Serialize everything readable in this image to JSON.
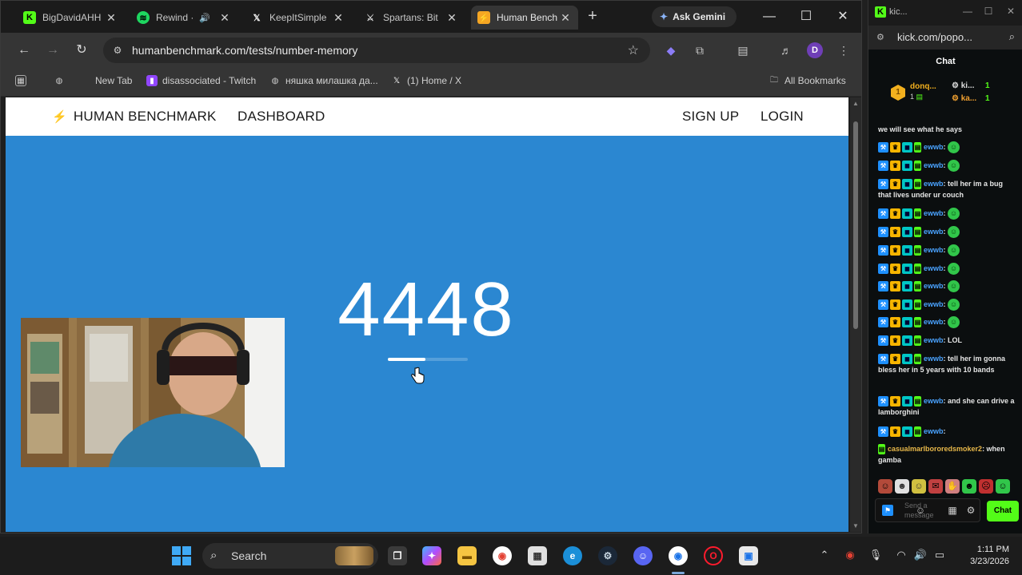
{
  "browser": {
    "tabs": [
      {
        "title": "BigDavidAHH",
        "fav": "K",
        "fav_color": "#53fc18",
        "active": false
      },
      {
        "title": "Rewind ·",
        "fav": "♫",
        "fav_color": "#1ed760",
        "active": false
      },
      {
        "title": "KeepItSimple",
        "fav": "𝕏",
        "fav_color": "#000000",
        "active": false
      },
      {
        "title": "Spartans: Bit",
        "fav": "⚔",
        "fav_color": "#777777",
        "active": false
      },
      {
        "title": "Human Bench",
        "fav": "⚡",
        "fav_color": "#f5a623",
        "active": true
      }
    ],
    "gemini_label": "Ask Gemini",
    "url": "humanbenchmark.com/tests/number-memory",
    "profile_initial": "D",
    "bookmarks": [
      {
        "label": "New Tab"
      },
      {
        "label": "disassociated - Twitch"
      },
      {
        "label": "няшка милашка да..."
      },
      {
        "label": "(1) Home / X"
      }
    ],
    "all_bookmarks_label": "All Bookmarks"
  },
  "humanbenchmark": {
    "logo_text": "HUMAN BENCHMARK",
    "nav_dashboard": "DASHBOARD",
    "nav_signup": "SIGN UP",
    "nav_login": "LOGIN",
    "number": "4448",
    "timer_remaining": 0.47,
    "page_bg": "#2b87d1"
  },
  "kick": {
    "window_title": "kic...",
    "url": "kick.com/popo...",
    "chat_header": "Chat",
    "pinned": {
      "name": "donq...",
      "count": "1",
      "rank_badge": "1",
      "right": [
        {
          "name": "ki...",
          "count": "1"
        },
        {
          "name": "ka...",
          "count": "1"
        }
      ]
    },
    "messages": [
      {
        "user": "",
        "text": "we will see what he says",
        "badges": false,
        "emote": false
      },
      {
        "user": "ewwb",
        "text": "",
        "badges": true,
        "emote": true
      },
      {
        "user": "ewwb",
        "text": "",
        "badges": true,
        "emote": true
      },
      {
        "user": "ewwb",
        "text": ": tell her im a bug that lives under ur couch",
        "badges": true,
        "emote": false
      },
      {
        "user": "ewwb",
        "text": "",
        "badges": true,
        "emote": true
      },
      {
        "user": "ewwb",
        "text": "",
        "badges": true,
        "emote": true
      },
      {
        "user": "ewwb",
        "text": "",
        "badges": true,
        "emote": true
      },
      {
        "user": "ewwb",
        "text": "",
        "badges": true,
        "emote": true
      },
      {
        "user": "ewwb",
        "text": "",
        "badges": true,
        "emote": true
      },
      {
        "user": "ewwb",
        "text": "",
        "badges": true,
        "emote": true
      },
      {
        "user": "ewwb",
        "text": "",
        "badges": true,
        "emote": true
      },
      {
        "user": "ewwb",
        "text": ": LOL",
        "badges": true,
        "emote": false
      },
      {
        "user": "ewwb",
        "text": ": tell her im gonna bless her in 5 years with 10 bands",
        "badges": true,
        "emote": false
      },
      {
        "user": "ewwb",
        "text": ": and she can drive a lamborghini",
        "badges": true,
        "emote": false
      },
      {
        "user": "ewwb",
        "text": ":",
        "badges": true,
        "emote": false
      },
      {
        "user": "casualmarlbororedsmoker2",
        "text": ": when gamba",
        "badges": false,
        "emote": false
      }
    ],
    "input_placeholder": "Send a message",
    "chat_button": "Chat"
  },
  "taskbar": {
    "search_label": "Search",
    "time": "1:11 PM",
    "date": "3/23/2026"
  }
}
